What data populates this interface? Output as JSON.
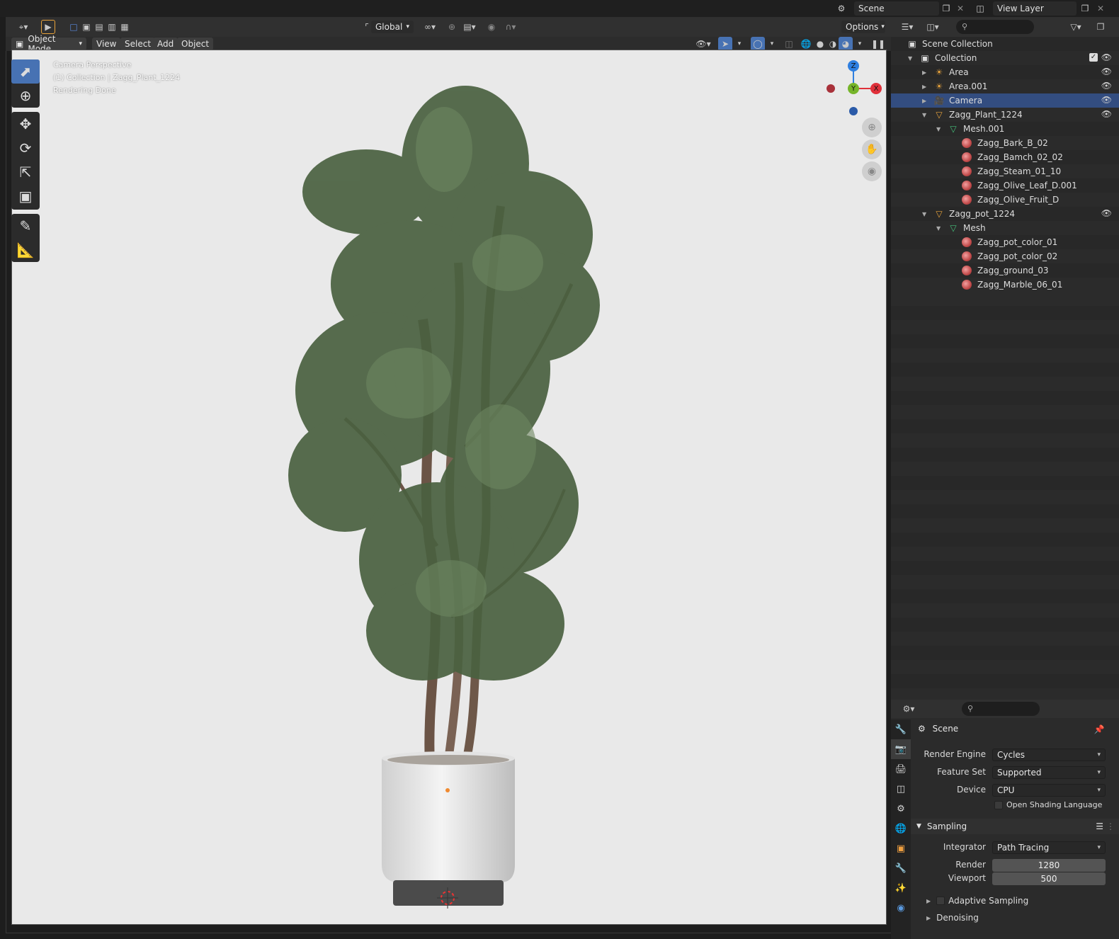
{
  "topbar": {
    "scene_label": "Scene",
    "view_layer_label": "View Layer"
  },
  "viewport_header": {
    "orientation": "Global",
    "options_label": "Options",
    "mode": "Object Mode",
    "menus": [
      "View",
      "Select",
      "Add",
      "Object"
    ]
  },
  "viewport_overlay": {
    "line1": "Camera Perspective",
    "line2": "(1) Collection | Zagg_Plant_1224",
    "line3": "Rendering Done"
  },
  "gizmo": {
    "z": "Z",
    "y": "Y",
    "x": "X"
  },
  "outliner": {
    "root": "Scene Collection",
    "collection": "Collection",
    "items": [
      {
        "label": "Area",
        "indent": 2,
        "type": "light"
      },
      {
        "label": "Area.001",
        "indent": 2,
        "type": "light"
      },
      {
        "label": "Camera",
        "indent": 2,
        "type": "camera",
        "selected": true
      },
      {
        "label": "Zagg_Plant_1224",
        "indent": 2,
        "type": "object"
      },
      {
        "label": "Mesh.001",
        "indent": 3,
        "type": "mesh"
      },
      {
        "label": "Zagg_Bark_B_02",
        "indent": 4,
        "type": "material"
      },
      {
        "label": "Zagg_Bamch_02_02",
        "indent": 4,
        "type": "material"
      },
      {
        "label": "Zagg_Steam_01_10",
        "indent": 4,
        "type": "material"
      },
      {
        "label": "Zagg_Olive_Leaf_D.001",
        "indent": 4,
        "type": "material"
      },
      {
        "label": "Zagg_Olive_Fruit_D",
        "indent": 4,
        "type": "material"
      },
      {
        "label": "Zagg_pot_1224",
        "indent": 2,
        "type": "object"
      },
      {
        "label": "Mesh",
        "indent": 3,
        "type": "mesh"
      },
      {
        "label": "Zagg_pot_color_01",
        "indent": 4,
        "type": "material"
      },
      {
        "label": "Zagg_pot_color_02",
        "indent": 4,
        "type": "material"
      },
      {
        "label": "Zagg_ground_03",
        "indent": 4,
        "type": "material"
      },
      {
        "label": "Zagg_Marble_06_01",
        "indent": 4,
        "type": "material"
      }
    ]
  },
  "properties": {
    "context": "Scene",
    "render_engine_label": "Render Engine",
    "render_engine": "Cycles",
    "feature_set_label": "Feature Set",
    "feature_set": "Supported",
    "device_label": "Device",
    "device": "CPU",
    "osl_label": "Open Shading Language",
    "sampling_label": "Sampling",
    "integrator_label": "Integrator",
    "integrator": "Path Tracing",
    "render_label": "Render",
    "render_samples": "1280",
    "viewport_label": "Viewport",
    "viewport_samples": "500",
    "adaptive_label": "Adaptive Sampling",
    "denoising_label": "Denoising"
  },
  "colors": {
    "accent": "#4772b3",
    "selection": "#334d80",
    "viewport_bg": "#e9e9e9",
    "axis_x": "#e0303a",
    "axis_y": "#76b52a",
    "axis_z": "#2f7fe0"
  }
}
